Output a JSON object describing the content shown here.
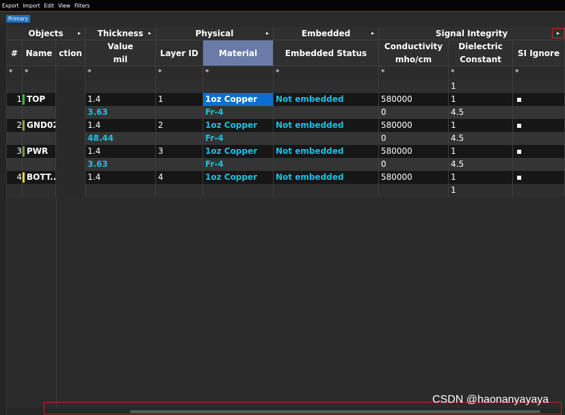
{
  "menubar": {
    "items": [
      "Export",
      "Import",
      "Edit",
      "View",
      "Filters"
    ]
  },
  "tabs": {
    "primary": "Primary"
  },
  "headers": {
    "objects": "Objects",
    "thickness": "Thickness",
    "physical": "Physical",
    "embedded": "Embedded",
    "signal_integrity": "Signal Integrity",
    "num": "#",
    "name": "Name",
    "direction_partial": "ction",
    "value": "Value",
    "value_unit": "mil",
    "layer_id": "Layer ID",
    "material": "Material",
    "embedded_status": "Embedded Status",
    "conductivity": "Conductivity",
    "conductivity_unit": "mho/cm",
    "dielectric_1": "Dielectric",
    "dielectric_2": "Constant",
    "si_ignore": "SI Ignore"
  },
  "filter_symbol": "*",
  "top_dielectric": "1",
  "bottom_dielectric": "1",
  "layers": [
    {
      "num": "1",
      "name": "TOP",
      "color": "#2fbf3a",
      "thickness": "1.4",
      "layer_id": "1",
      "material": "1oz Copper",
      "status": "Not embedded",
      "conductivity": "580000",
      "dielectric": "1",
      "sub": {
        "thickness": "3.63",
        "material": "Fr-4",
        "conductivity": "0",
        "dielectric": "4.5"
      }
    },
    {
      "num": "2",
      "name": "GND02",
      "color": "#8aa83a",
      "thickness": "1.4",
      "layer_id": "2",
      "material": "1oz Copper",
      "status": "Not embedded",
      "conductivity": "580000",
      "dielectric": "1",
      "sub": {
        "thickness": "48.44",
        "material": "Fr-4",
        "conductivity": "0",
        "dielectric": "4.5"
      }
    },
    {
      "num": "3",
      "name": "PWR",
      "color": "#7a9a3a",
      "thickness": "1.4",
      "layer_id": "3",
      "material": "1oz Copper",
      "status": "Not embedded",
      "conductivity": "580000",
      "dielectric": "1",
      "sub": {
        "thickness": "3.63",
        "material": "Fr-4",
        "conductivity": "0",
        "dielectric": "4.5"
      }
    },
    {
      "num": "4",
      "name": "BOTT...",
      "color": "#e8d82a",
      "thickness": "1.4",
      "layer_id": "4",
      "material": "1oz Copper",
      "status": "Not embedded",
      "conductivity": "580000",
      "dielectric": "1",
      "sub": null
    }
  ],
  "watermark": "CSDN @haonanyayaya",
  "scroll_arrow": "▸"
}
